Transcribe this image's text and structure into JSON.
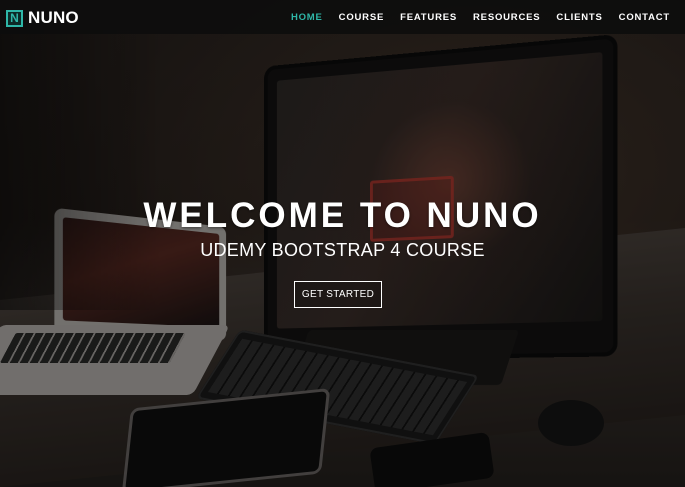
{
  "brand": {
    "icon_letter": "N",
    "name": "NUNO",
    "accent_color": "#2fb7a8"
  },
  "nav": {
    "items": [
      {
        "label": "HOME",
        "active": true
      },
      {
        "label": "COURSE",
        "active": false
      },
      {
        "label": "FEATURES",
        "active": false
      },
      {
        "label": "RESOURCES",
        "active": false
      },
      {
        "label": "CLIENTS",
        "active": false
      },
      {
        "label": "CONTACT",
        "active": false
      }
    ]
  },
  "hero": {
    "title": "WELCOME TO NUNO",
    "subtitle": "UDEMY BOOTSTRAP 4 COURSE",
    "cta_label": "GET STARTED",
    "background_image": "desk-workspace-photo"
  }
}
